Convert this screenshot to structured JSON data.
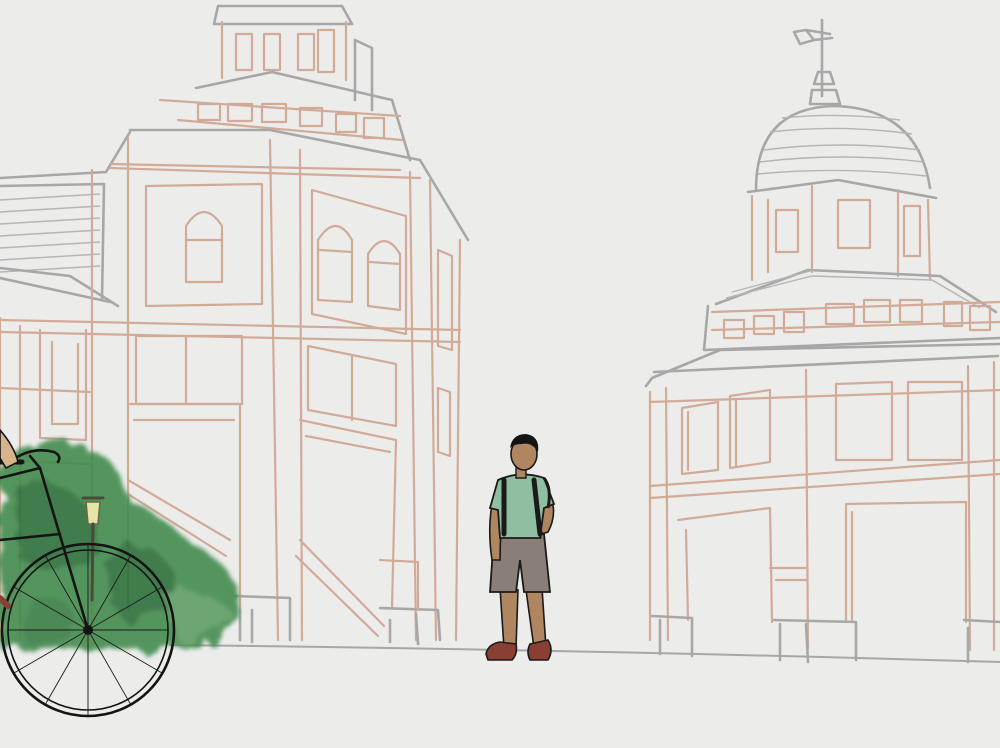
{
  "scene": {
    "background": "#ececeb",
    "colors": {
      "building_outline": "#d2ab98",
      "roof_outline": "#a7a7a7",
      "foliage": "#2f7a3e",
      "shirt": "#8fbea0",
      "shorts": "#8a7f78",
      "skin": "#b08660",
      "shoes": "#8a3f34",
      "bicycle": "#141414"
    },
    "elements": [
      "left-building",
      "dome-building",
      "student-figure",
      "bicycle",
      "foliage-bush",
      "lamp-post",
      "ground-line"
    ]
  }
}
